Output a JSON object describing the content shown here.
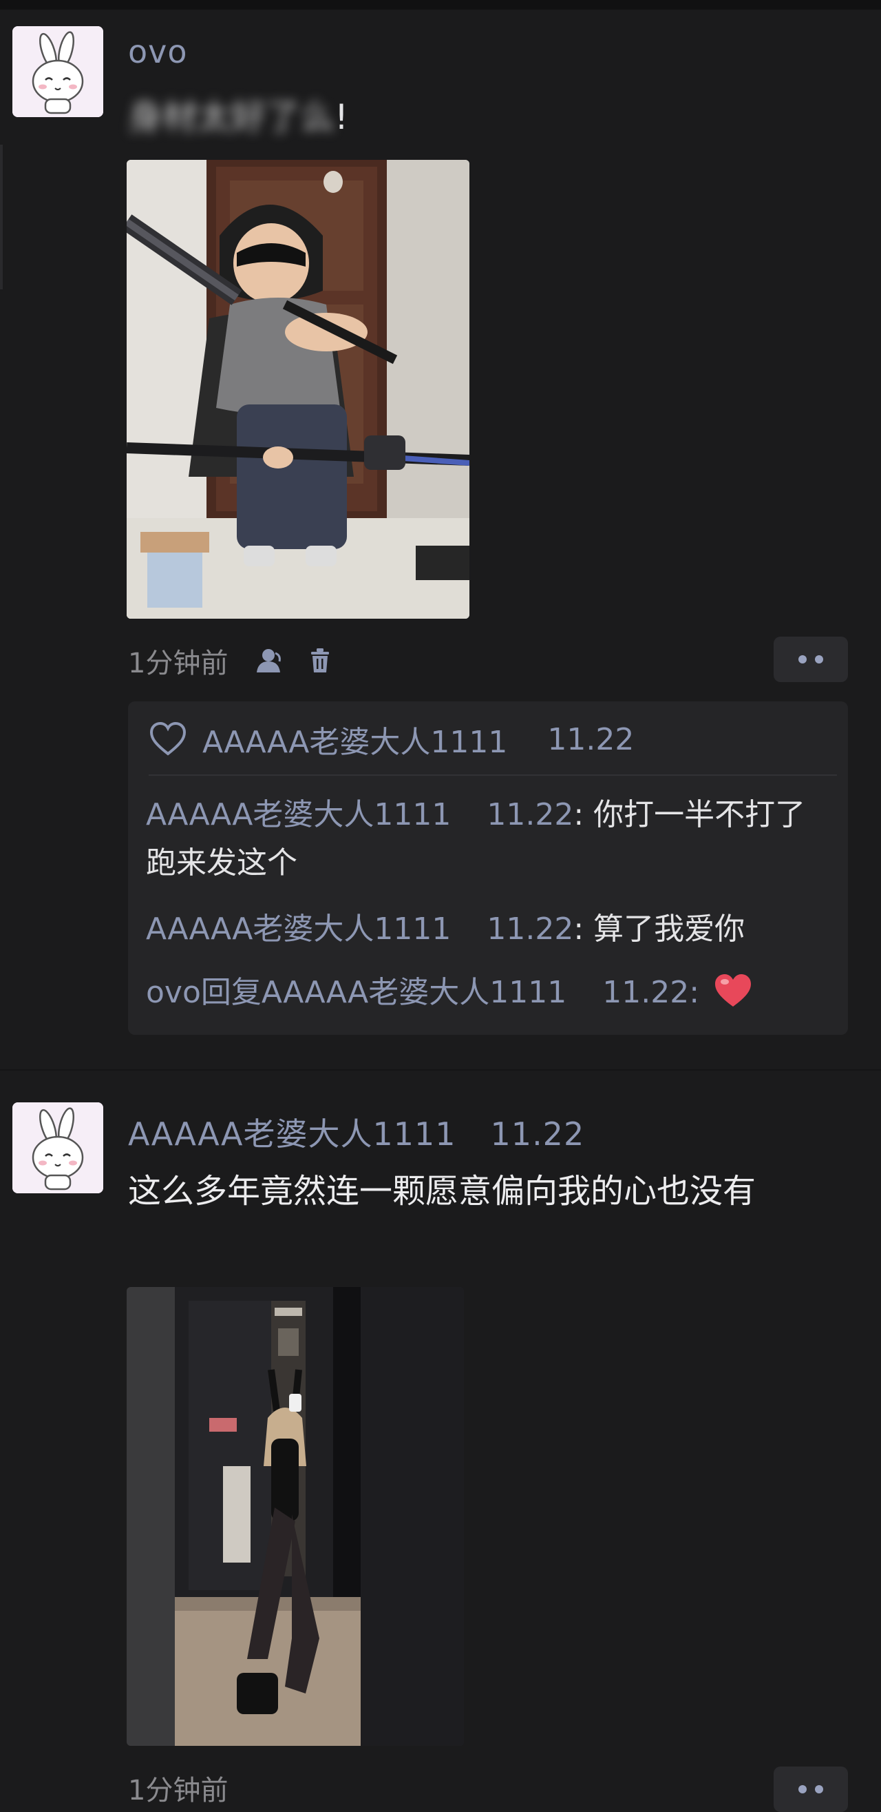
{
  "posts": [
    {
      "author": "ovo",
      "blurred_text": "身材太好了么",
      "blurred_text_end": "!",
      "time": "1分钟前",
      "likes": {
        "user": "AAAAA老婆大人1111",
        "time": "11.22"
      },
      "comments": [
        {
          "author": "AAAAA老婆大人1111",
          "time": "11.22",
          "sep": ": ",
          "text": "你打一半不打了跑来发这个"
        },
        {
          "author": "AAAAA老婆大人1111",
          "time": "11.22",
          "sep": ": ",
          "text": "算了我爱你"
        },
        {
          "author": "ovo回复AAAAA老婆大人1111",
          "time": "11.22",
          "sep": ": ",
          "emoji": "red-heart"
        }
      ]
    },
    {
      "author": "AAAAA老婆大人1111",
      "author_time": "11.22",
      "text": "这么多年竟然连一颗愿意偏向我的心也没有",
      "time": "1分钟前"
    }
  ],
  "icons": {
    "avatar": "bunny-avatar-icon",
    "visibility": "person-icon",
    "delete": "trash-icon",
    "like": "heart-outline-icon",
    "more": "more-dots-icon"
  },
  "colors": {
    "background": "#1b1b1c",
    "card": "#252527",
    "name": "#8d97b3",
    "text": "#e9e9ea",
    "meta": "#8a8a8e",
    "heart": "#e8485a"
  }
}
